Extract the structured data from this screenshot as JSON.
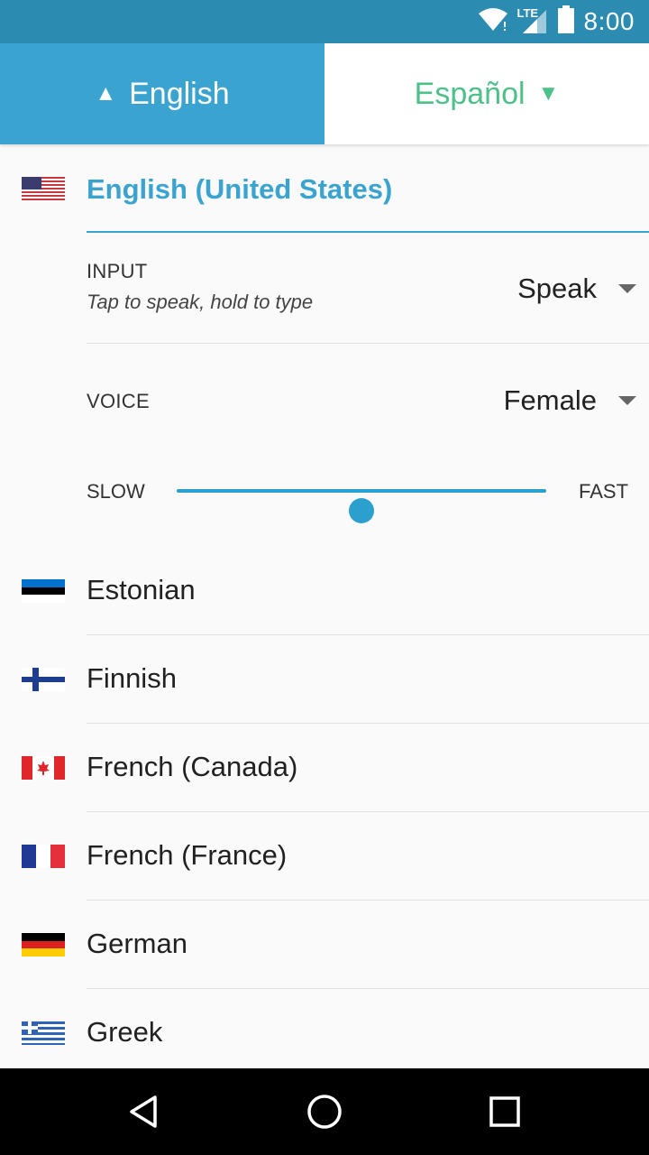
{
  "status_bar": {
    "time": "8:00",
    "network": "LTE",
    "icons": [
      "wifi-icon",
      "signal-icon",
      "battery-icon"
    ]
  },
  "header": {
    "source_language": "English",
    "target_language": "Español",
    "source_color": "#3aa3cf",
    "target_color": "#4ec08a"
  },
  "selected_language": {
    "name": "English (United States)",
    "flag": "us-flag-icon"
  },
  "input_setting": {
    "label": "INPUT",
    "hint": "Tap to speak, hold to type",
    "value": "Speak"
  },
  "voice_setting": {
    "label": "VOICE",
    "value": "Female"
  },
  "speed_setting": {
    "slow_label": "SLOW",
    "fast_label": "FAST",
    "level": 0.5
  },
  "languages": [
    {
      "name": "Estonian",
      "flag": "estonia-flag-icon"
    },
    {
      "name": "Finnish",
      "flag": "finland-flag-icon"
    },
    {
      "name": "French (Canada)",
      "flag": "canada-flag-icon"
    },
    {
      "name": "French (France)",
      "flag": "france-flag-icon"
    },
    {
      "name": "German",
      "flag": "germany-flag-icon"
    },
    {
      "name": "Greek",
      "flag": "greece-flag-icon"
    }
  ],
  "nav_bar": {
    "buttons": [
      "back-icon",
      "home-icon",
      "recents-icon"
    ]
  }
}
